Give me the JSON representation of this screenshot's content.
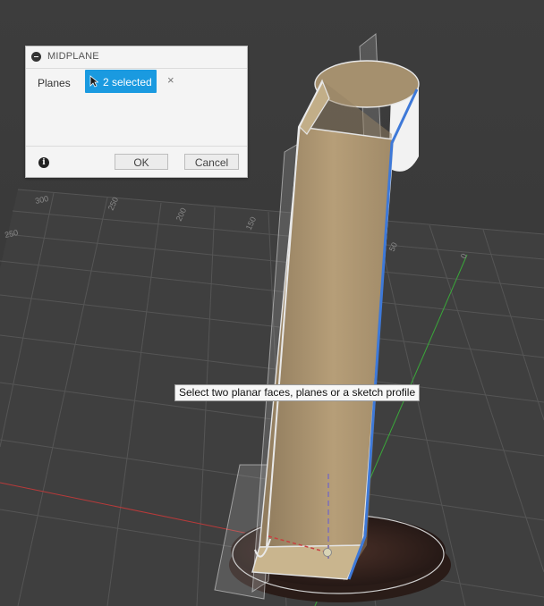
{
  "panel": {
    "title": "MIDPLANE",
    "planes_label": "Planes",
    "selection_label": "2 selected",
    "clear_glyph": "×",
    "info_glyph": "i",
    "ok_label": "OK",
    "cancel_label": "Cancel",
    "accent_color": "#1a9ae0"
  },
  "tooltip": {
    "text": "Select two planar faces, planes or a sketch profile"
  },
  "grid": {
    "labels": [
      "300",
      "250",
      "200",
      "150",
      "250",
      "50",
      "0"
    ]
  },
  "icons": {
    "collapse": "collapse-icon",
    "cursor": "cursor-arrow-icon",
    "clear": "close-icon",
    "info": "info-icon"
  }
}
